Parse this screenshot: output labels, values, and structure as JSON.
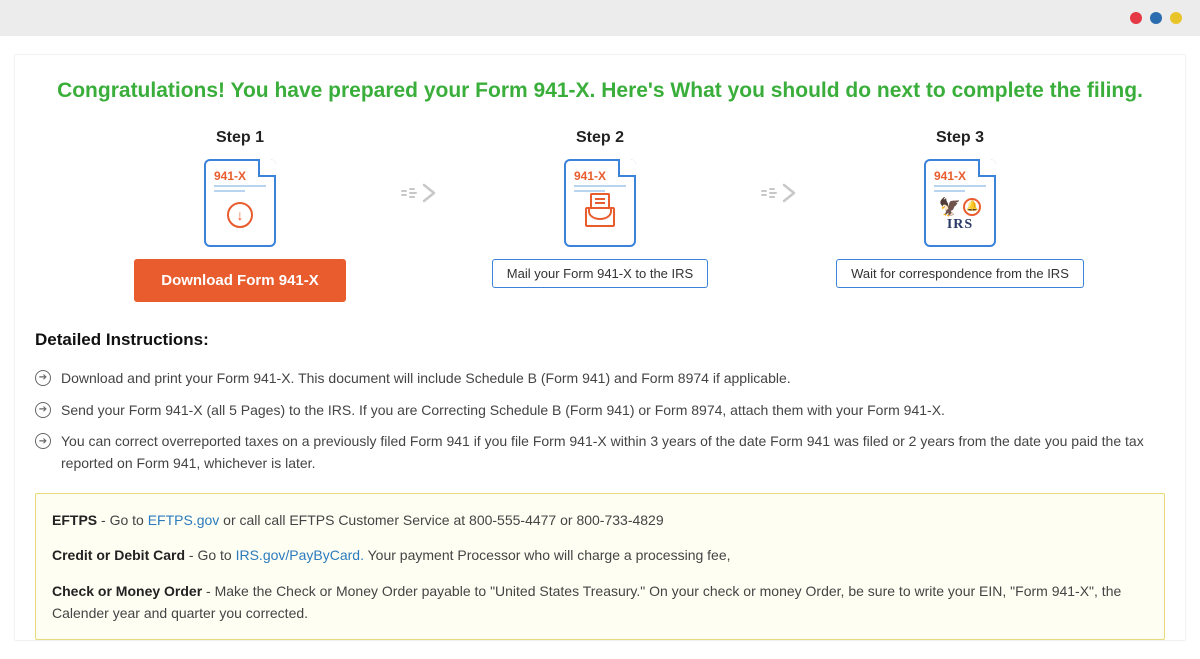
{
  "header": {
    "congrats": "Congratulations! You have prepared your Form 941-X. Here's What you should do next to complete the filing."
  },
  "steps": [
    {
      "title": "Step 1",
      "doc_label": "941-X",
      "action": "Download Form 941-X"
    },
    {
      "title": "Step 2",
      "doc_label": "941-X",
      "action": "Mail your Form 941-X to the IRS"
    },
    {
      "title": "Step 3",
      "doc_label": "941-X",
      "action": "Wait for correspondence from the IRS",
      "irs_label": "IRS"
    }
  ],
  "detailed_header": "Detailed Instructions:",
  "instructions": [
    "Download and print your Form 941-X. This document will include Schedule B (Form 941) and Form 8974 if applicable.",
    "Send your Form 941-X (all 5 Pages) to the IRS. If you are Correcting Schedule B (Form 941) or Form 8974, attach them with your Form 941-X.",
    "You can correct overreported taxes on a previously filed Form 941 if you file Form 941-X within 3 years of the date Form 941 was filed or 2 years from the date you paid the tax reported on Form 941, whichever is later."
  ],
  "payments": {
    "eftps": {
      "label": "EFTPS",
      "prefix": " - Go to ",
      "link": "EFTPS.gov",
      "suffix": " or call call EFTPS Customer Service at 800-555-4477 or 800-733-4829"
    },
    "card": {
      "label": "Credit or Debit Card",
      "prefix": " - Go to ",
      "link": "IRS.gov/PayByCard.",
      "suffix": " Your payment Processor who will charge a processing fee,"
    },
    "check": {
      "label": "Check or Money Order",
      "text": " - Make the Check or Money Order payable to \"United States Treasury.\" On your check or money Order, be sure to write your EIN, \"Form 941-X\", the Calender year and quarter you corrected."
    }
  }
}
